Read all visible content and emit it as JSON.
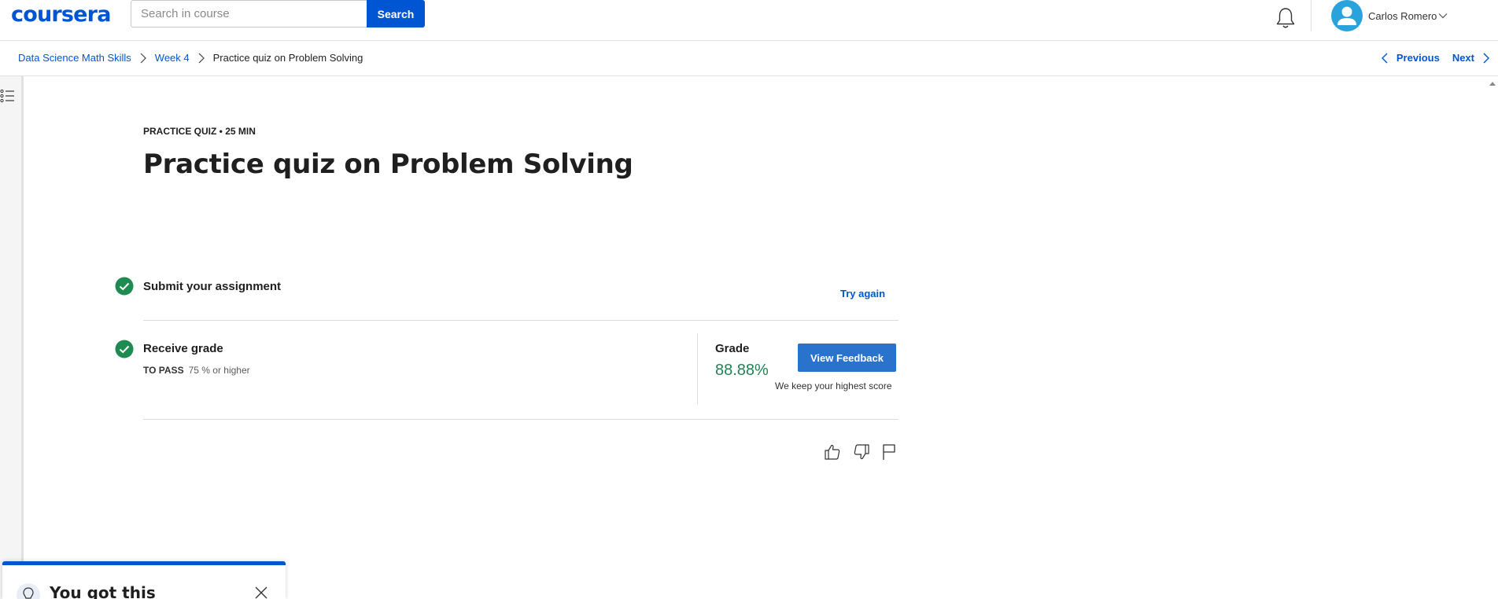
{
  "header": {
    "logo_text": "coursera",
    "search_placeholder": "Search in course",
    "search_button_label": "Search",
    "user_name": "Carlos Romero"
  },
  "breadcrumb": {
    "items": [
      "Data Science Math Skills",
      "Week 4"
    ],
    "current": "Practice quiz on Problem Solving"
  },
  "navigation": {
    "previous_label": "Previous",
    "next_label": "Next"
  },
  "quiz": {
    "kicker": "PRACTICE QUIZ • 25 MIN",
    "title": "Practice quiz on Problem Solving",
    "steps": {
      "submit": {
        "label": "Submit your assignment",
        "action_label": "Try again"
      },
      "grade": {
        "label": "Receive grade",
        "to_pass_label": "TO PASS",
        "to_pass_value": "75 % or higher",
        "grade_label": "Grade",
        "grade_value": "88.88%",
        "feedback_button_label": "View Feedback",
        "note": "We keep your highest score"
      }
    },
    "feedback_icons": [
      "thumbs-up-icon",
      "thumbs-down-icon",
      "flag-icon"
    ]
  },
  "tip_card": {
    "title": "You got this"
  },
  "colors": {
    "brand_blue": "#0056d2",
    "button_blue": "#2a73cc",
    "success_green": "#1f8354",
    "check_green": "#1e8c50"
  }
}
